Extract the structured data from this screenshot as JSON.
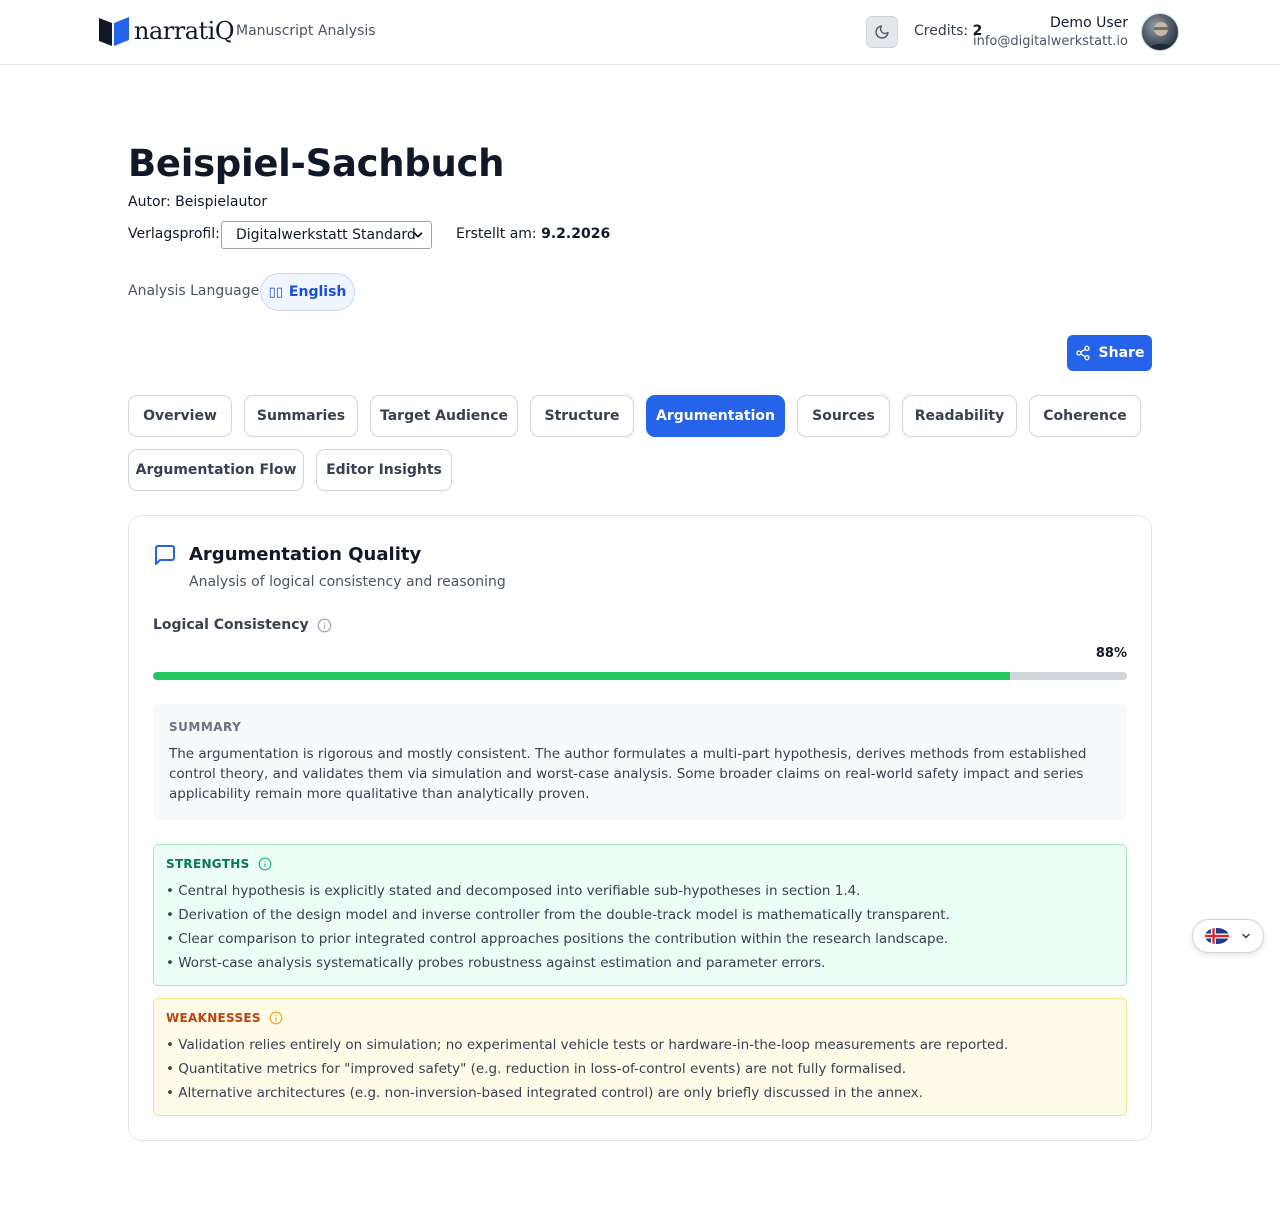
{
  "header": {
    "logo_text": "narratiQ",
    "app_subtitle": "Manuscript Analysis",
    "credits_label": "Credits:",
    "credits_value": "2",
    "user_name": "Demo User",
    "user_email": "info@digitalwerkstatt.io"
  },
  "book": {
    "title": "Beispiel-Sachbuch",
    "author": "Autor: Beispielautor",
    "profile_label": "Verlagsprofil:",
    "profile_value": "Digitalwerkstatt Standard",
    "created_label": "Erstellt am:",
    "created_value": "9.2.2026",
    "analysis_language_label": "Analysis Language:",
    "analysis_language_value": "English"
  },
  "share_label": "Share",
  "tabs": [
    {
      "label": "Overview"
    },
    {
      "label": "Summaries"
    },
    {
      "label": "Target Audience"
    },
    {
      "label": "Structure"
    },
    {
      "label": "Argumentation",
      "active": true
    },
    {
      "label": "Sources"
    },
    {
      "label": "Readability"
    },
    {
      "label": "Coherence"
    },
    {
      "label": "Argumentation Flow"
    },
    {
      "label": "Editor Insights"
    }
  ],
  "card": {
    "title": "Argumentation Quality",
    "subtitle": "Analysis of logical consistency and reasoning",
    "metric_label": "Logical Consistency",
    "metric_value": "88%",
    "metric_fraction": 0.88,
    "summary_heading": "SUMMARY",
    "summary_text": "The argumentation is rigorous and mostly consistent. The author formulates a multi-part hypothesis, derives methods from established control theory, and validates them via simulation and worst-case analysis. Some broader claims on real-world safety impact and series applicability remain more qualitative than analytically proven.",
    "strengths_heading": "STRENGTHS",
    "strengths": [
      "• Central hypothesis is explicitly stated and decomposed into verifiable sub-hypotheses in section 1.4.",
      "• Derivation of the design model and inverse controller from the double-track model is mathematically transparent.",
      "• Clear comparison to prior integrated control approaches positions the contribution within the research landscape.",
      "• Worst-case analysis systematically probes robustness against estimation and parameter errors."
    ],
    "weaknesses_heading": "WEAKNESSES",
    "weaknesses": [
      "• Validation relies entirely on simulation; no experimental vehicle tests or hardware-in-the-loop measurements are reported.",
      "• Quantitative metrics for \"improved safety\" (e.g. reduction in loss-of-control events) are not fully formalised.",
      "• Alternative architectures (e.g. non-inversion-based integrated control) are only briefly discussed in the annex."
    ]
  },
  "colors": {
    "accent": "#2563eb",
    "progress": "#22c55e",
    "strengths_bg": "#ecfdf5",
    "weaknesses_bg": "#fefbe8"
  }
}
